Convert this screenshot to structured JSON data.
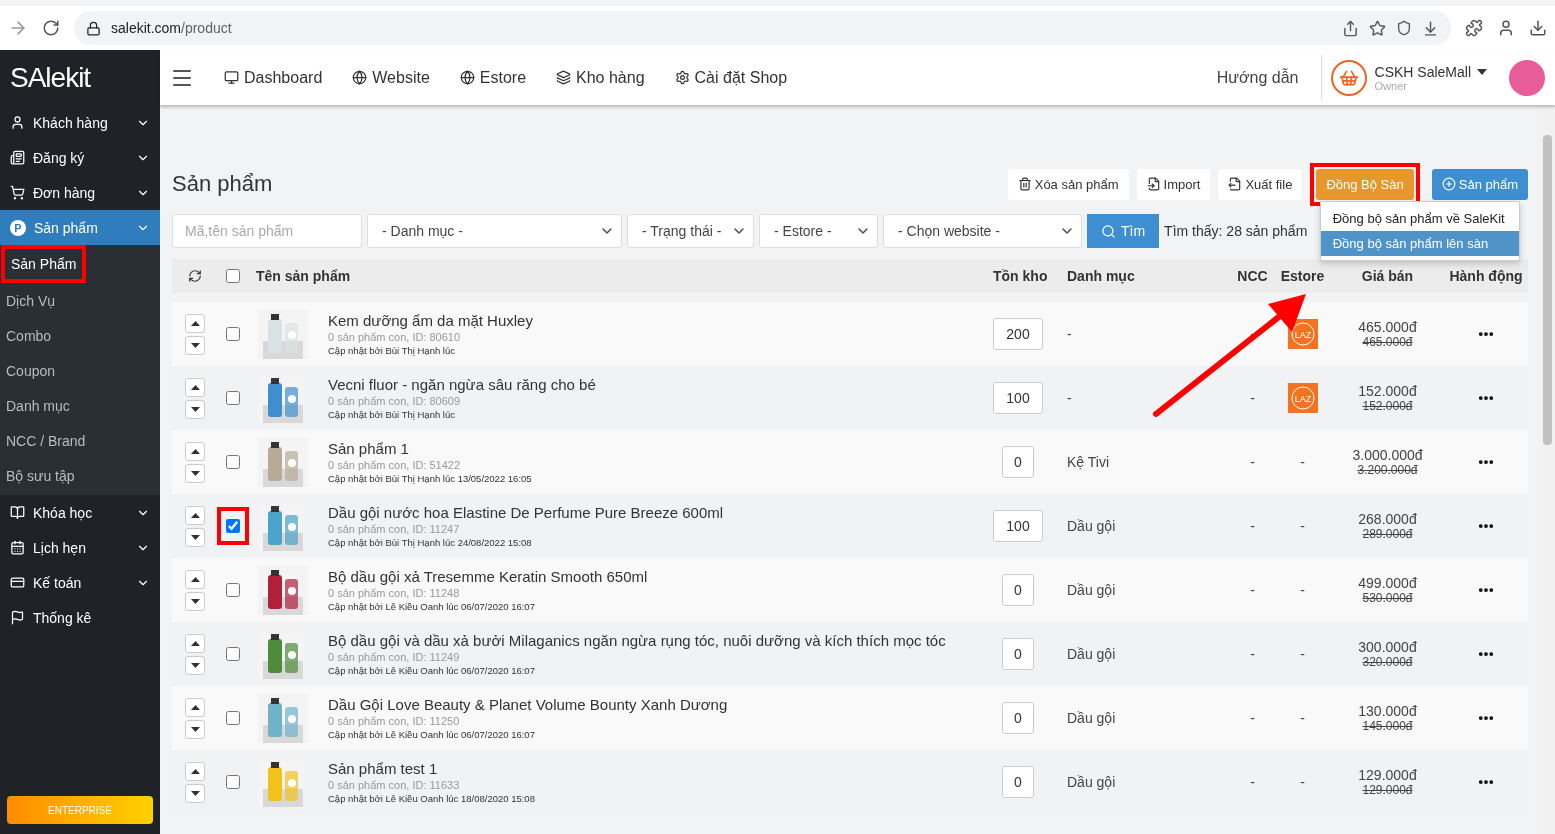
{
  "browser": {
    "url_host": "salekit.com",
    "url_path": "/product"
  },
  "sidebar": {
    "logo": "SAlekit",
    "items": [
      {
        "kind": "user",
        "label": "Khách hàng",
        "has_submenu": true,
        "selected": false
      },
      {
        "kind": "form",
        "label": "Đăng ký",
        "has_submenu": true,
        "selected": false
      },
      {
        "kind": "cart",
        "label": "Đơn hàng",
        "has_submenu": true,
        "selected": false
      },
      {
        "kind": "product",
        "label": "Sản phẩm",
        "icon_text": "P",
        "has_submenu": true,
        "expanded": true,
        "selected": true,
        "children": [
          {
            "label": "Sản Phẩm",
            "selected": true,
            "highlighted": true
          },
          {
            "label": "Dịch Vụ",
            "selected": false,
            "highlighted": false
          },
          {
            "label": "Combo",
            "selected": false,
            "highlighted": false
          },
          {
            "label": "Coupon",
            "selected": false,
            "highlighted": false
          },
          {
            "label": "Danh mục",
            "selected": false,
            "highlighted": false
          },
          {
            "label": "NCC / Brand",
            "selected": false,
            "highlighted": false
          },
          {
            "label": "Bộ sưu tập",
            "selected": false,
            "highlighted": false
          }
        ]
      },
      {
        "kind": "course",
        "label": "Khóa học",
        "has_submenu": true,
        "selected": false
      },
      {
        "kind": "calendar",
        "label": "Lịch hẹn",
        "has_submenu": true,
        "selected": false
      },
      {
        "kind": "card",
        "label": "Kế toán",
        "has_submenu": true,
        "selected": false
      },
      {
        "kind": "flag",
        "label": "Thống kê",
        "has_submenu": false,
        "selected": false
      }
    ],
    "plan_button": "ENTERPRISE"
  },
  "topnav": {
    "items": [
      {
        "kind": "monitor",
        "label": "Dashboard"
      },
      {
        "kind": "globe",
        "label": "Website"
      },
      {
        "kind": "globe",
        "label": "Estore"
      },
      {
        "kind": "layers",
        "label": "Kho hàng"
      },
      {
        "kind": "gear",
        "label": "Cài đặt Shop"
      }
    ],
    "help": "Hướng dẫn",
    "user": {
      "name": "CSKH SaleMall",
      "role": "Owner"
    }
  },
  "page": {
    "title": "Sản phẩm",
    "toolbar": [
      {
        "kind": "trash",
        "label": "Xóa sản phẩm",
        "highlighted": false
      },
      {
        "kind": "import",
        "label": "Import",
        "highlighted": false
      },
      {
        "kind": "export",
        "label": "Xuất file",
        "highlighted": false
      },
      {
        "kind": "sync",
        "label": "Đồng Bộ Sàn",
        "highlighted": true,
        "expanded": true
      },
      {
        "kind": "add",
        "label": "Sản phẩm",
        "highlighted": false
      }
    ],
    "sync_menu": [
      {
        "label": "Đồng bộ sản phẩm về SaleKit",
        "selected": false
      },
      {
        "label": "Đồng bộ sản phẩm lên sàn",
        "selected": true
      }
    ],
    "filters": {
      "search": {
        "placeholder": "Mã,tên sản phẩm"
      },
      "selects": [
        "- Danh mục -",
        "- Trạng thái -",
        "- Estore -",
        "- Chọn website -"
      ],
      "search_button": "Tìm",
      "result": "Tìm thấy: 28 sản phẩm"
    },
    "callout_arrow": true
  },
  "table": {
    "all_checked": false,
    "columns": [
      "Tên sản phẩm",
      "Tồn kho",
      "Danh mục",
      "NCC",
      "Estore",
      "Giá bán",
      "Hành động"
    ],
    "rows": [
      {
        "name": "Kem dưỡng ẩm da mặt Huxley",
        "sub": "0 sản phẩm con, ID: 80610",
        "updated": "Cập nhật bởi Bùi Thị Hạnh lúc",
        "stock": "200",
        "category": "-",
        "ncc": "-",
        "estore": {
          "kind": "logo",
          "label": "LAZ"
        },
        "price": "465.000đ",
        "old_price": "465.000đ",
        "checked": false,
        "highlighted": false,
        "color": "#d9e2e4"
      },
      {
        "name": "Vecni fluor - ngăn ngừa sâu răng cho bé",
        "sub": "0 sản phẩm con, ID: 80609",
        "updated": "Cập nhật bởi Bùi Thị Hạnh lúc",
        "stock": "100",
        "category": "-",
        "ncc": "-",
        "estore": {
          "kind": "logo",
          "label": "LAZ"
        },
        "price": "152.000đ",
        "old_price": "152.000đ",
        "checked": false,
        "highlighted": false,
        "color": "#3f8fd0"
      },
      {
        "name": "Sản phẩm 1",
        "sub": "0 sản phẩm con, ID: 51422",
        "updated": "Cập nhật bởi Bùi Thị Hạnh lúc 13/05/2022 16:05",
        "stock": "0",
        "category": "Kệ Tivi",
        "ncc": "-",
        "estore": {
          "kind": "text",
          "label": "-"
        },
        "price": "3.000.000đ",
        "old_price": "3.200.000đ",
        "checked": false,
        "highlighted": false,
        "color": "#b7ab95"
      },
      {
        "name": "Dầu gội nước hoa Elastine De Perfume Pure Breeze 600ml",
        "sub": "0 sản phẩm con, ID: 11247",
        "updated": "Cập nhật bởi Bùi Thị Hạnh lúc 24/08/2022 15:08",
        "stock": "100",
        "category": "Dầu gội",
        "ncc": "-",
        "estore": {
          "kind": "text",
          "label": "-"
        },
        "price": "268.000đ",
        "old_price": "289.000đ",
        "checked": true,
        "highlighted": true,
        "color": "#4aa3c8"
      },
      {
        "name": "Bộ dầu gội xả Tresemme Keratin Smooth 650ml",
        "sub": "0 sản phẩm con, ID: 11248",
        "updated": "Cập nhật bởi Lê Kiều Oanh lúc 06/07/2020 16:07",
        "stock": "0",
        "category": "Dầu gội",
        "ncc": "-",
        "estore": {
          "kind": "text",
          "label": "-"
        },
        "price": "499.000đ",
        "old_price": "530.000đ",
        "checked": false,
        "highlighted": false,
        "color": "#b0203a"
      },
      {
        "name": "Bộ dầu gội và dầu xả bưởi Milaganics ngăn ngừa rụng tóc, nuôi dưỡng và kích thích mọc tóc",
        "sub": "0 sản phẩm con, ID: 11249",
        "updated": "Cập nhật bởi Lê Kiều Oanh lúc 06/07/2020 16:07",
        "stock": "0",
        "category": "Dầu gội",
        "ncc": "-",
        "estore": {
          "kind": "text",
          "label": "-"
        },
        "price": "300.000đ",
        "old_price": "320.000đ",
        "checked": false,
        "highlighted": false,
        "color": "#4d8a3a"
      },
      {
        "name": "Dầu Gội Love Beauty & Planet Volume Bounty Xanh Dương",
        "sub": "0 sản phẩm con, ID: 11250",
        "updated": "Cập nhật bởi Lê Kiều Oanh lúc 06/07/2020 16:07",
        "stock": "0",
        "category": "Dầu gội",
        "ncc": "-",
        "estore": {
          "kind": "text",
          "label": "-"
        },
        "price": "130.000đ",
        "old_price": "145.000đ",
        "checked": false,
        "highlighted": false,
        "color": "#6fb3c9"
      },
      {
        "name": "Sản phẩm test 1",
        "sub": "0 sản phẩm con, ID: 11633",
        "updated": "Cập nhật bởi Lê Kiều Oanh lúc 18/08/2020 15:08",
        "stock": "0",
        "category": "Dầu gội",
        "ncc": "-",
        "estore": {
          "kind": "text",
          "label": "-"
        },
        "price": "129.000đ",
        "old_price": "129.000đ",
        "checked": false,
        "highlighted": false,
        "color": "#f2c21b"
      }
    ]
  }
}
